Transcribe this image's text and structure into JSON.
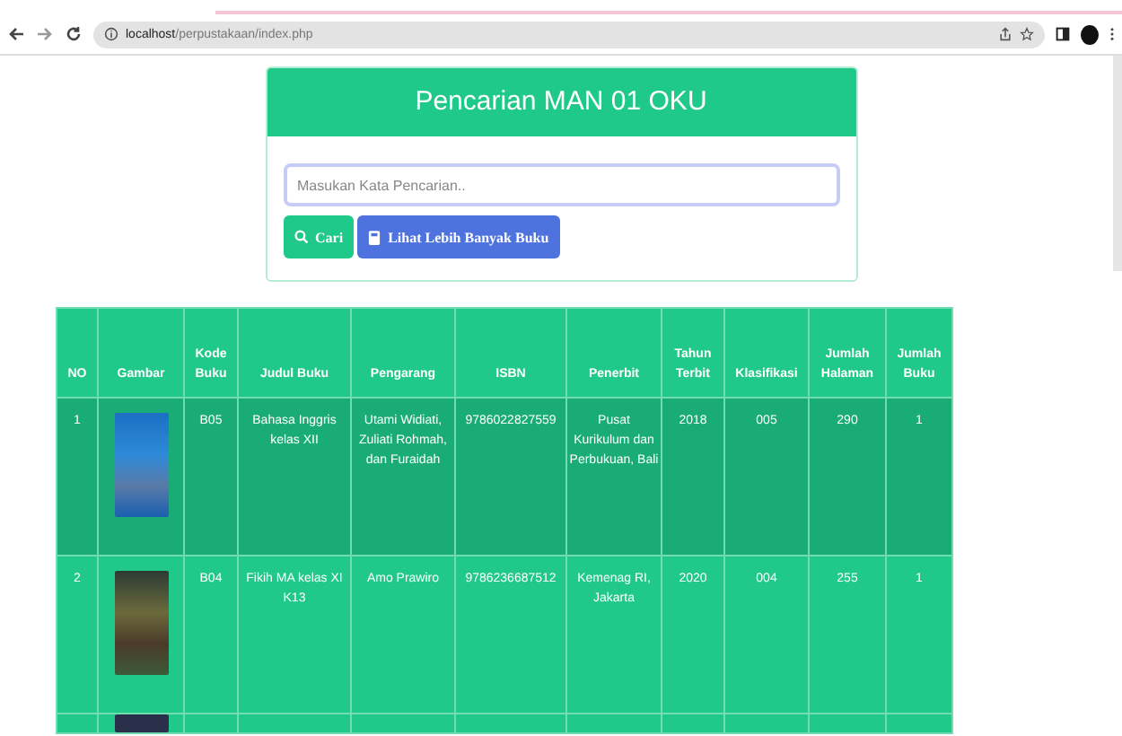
{
  "browser": {
    "url_host": "localhost",
    "url_path": "/perpustakaan/index.php"
  },
  "search_card": {
    "title": "Pencarian MAN 01 OKU",
    "placeholder": "Masukan Kata Pencarian..",
    "buttons": [
      {
        "label": "Cari",
        "kind": "search"
      },
      {
        "label": "Lihat Lebih Banyak Buku",
        "kind": "more"
      }
    ]
  },
  "table": {
    "columns": [
      "NO",
      "Gambar",
      "Kode Buku",
      "Judul Buku",
      "Pengarang",
      "ISBN",
      "Penerbit",
      "Tahun Terbit",
      "Klasifikasi",
      "Jumlah Halaman",
      "Jumlah Buku"
    ],
    "rows": [
      {
        "highlighted": true,
        "cells": [
          "1",
          "",
          "B05",
          "Bahasa Inggris kelas XII",
          "Utami Widiati, Zuliati Rohmah, dan Furaidah",
          "9786022827559",
          "Pusat Kurikulum dan Perbukuan, Bali",
          "2018",
          "005",
          "290",
          "1"
        ]
      },
      {
        "highlighted": false,
        "cells": [
          "2",
          "",
          "B04",
          "Fikih MA kelas XI K13",
          "Amo Prawiro",
          "9786236687512",
          "Kemenag RI, Jakarta",
          "2020",
          "004",
          "255",
          "1"
        ]
      }
    ]
  }
}
